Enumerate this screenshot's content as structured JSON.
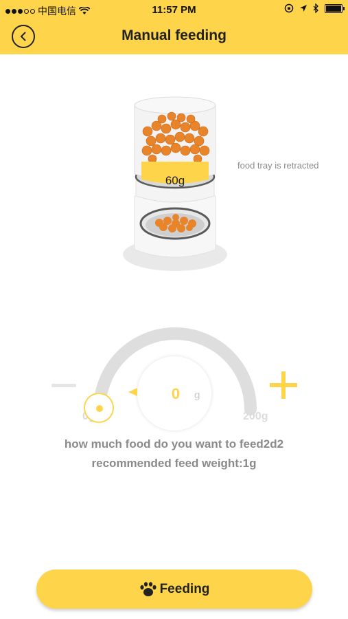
{
  "status_bar": {
    "carrier": "中国电信",
    "time": "11:57 PM"
  },
  "header": {
    "title": "Manual feeding",
    "back_icon": "chevron-left-icon"
  },
  "feeder": {
    "food_weight_label": "60g",
    "tray_status": "food tray is retracted"
  },
  "dial": {
    "value": "0",
    "unit": "g",
    "min_label": "0g",
    "max_label": "200g",
    "level": 0
  },
  "text": {
    "question": "how much food do you want to feed2d2",
    "recommendation": "recommended feed weight:1g"
  },
  "feed_button": {
    "label": "Feeding",
    "icon": "paw-icon"
  },
  "colors": {
    "accent": "#fdd44a",
    "text_gray": "#8a8a8a",
    "track_gray": "#dedede"
  }
}
